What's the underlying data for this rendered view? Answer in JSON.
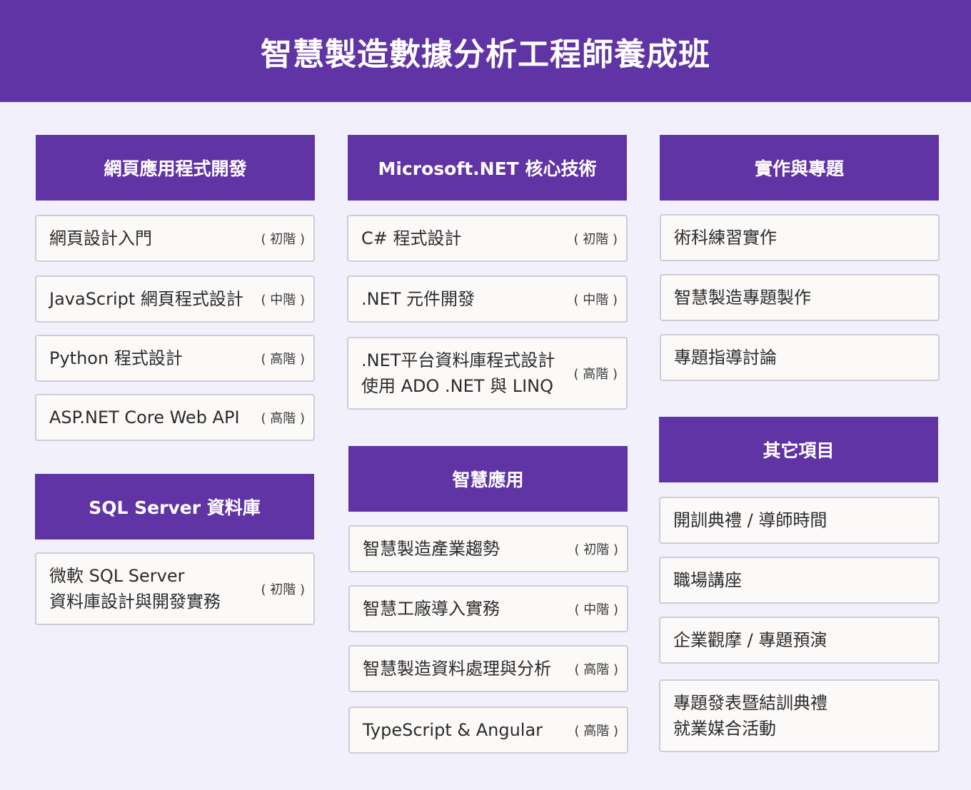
{
  "title": "智慧製造數據分析工程師養成班",
  "columns": [
    {
      "sections": [
        {
          "title": "網頁應用程式開發",
          "items": [
            {
              "lines": [
                "網頁設計入門"
              ],
              "level": "( 初階 )"
            },
            {
              "lines": [
                "JavaScript 網頁程式設計"
              ],
              "level": "( 中階 )"
            },
            {
              "lines": [
                "Python 程式設計"
              ],
              "level": "( 高階 )"
            },
            {
              "lines": [
                "ASP.NET Core Web API"
              ],
              "level": "( 高階 )"
            }
          ]
        },
        {
          "title": "SQL Server 資料庫",
          "items": [
            {
              "lines": [
                "微軟 SQL Server",
                "資料庫設計與開發實務"
              ],
              "level": "( 初階 )"
            }
          ]
        }
      ]
    },
    {
      "sections": [
        {
          "title": "Microsoft.NET 核心技術",
          "items": [
            {
              "lines": [
                "C# 程式設計"
              ],
              "level": "( 初階 )"
            },
            {
              "lines": [
                ".NET 元件開發"
              ],
              "level": "( 中階 )"
            },
            {
              "lines": [
                ".NET平台資料庫程式設計",
                "使用 ADO .NET 與 LINQ"
              ],
              "level": "( 高階 )"
            }
          ]
        },
        {
          "title": "智慧應用",
          "items": [
            {
              "lines": [
                "智慧製造產業趨勢"
              ],
              "level": "( 初階 )"
            },
            {
              "lines": [
                "智慧工廠導入實務"
              ],
              "level": "( 中階 )"
            },
            {
              "lines": [
                "智慧製造資料處理與分析"
              ],
              "level": "( 高階 )"
            },
            {
              "lines": [
                "TypeScript & Angular"
              ],
              "level": "( 高階 )"
            }
          ]
        }
      ]
    },
    {
      "sections": [
        {
          "title": "實作與專題",
          "items": [
            {
              "lines": [
                "術科練習實作"
              ]
            },
            {
              "lines": [
                "智慧製造專題製作"
              ]
            },
            {
              "lines": [
                "專題指導討論"
              ]
            }
          ]
        },
        {
          "title": "其它項目",
          "items": [
            {
              "lines": [
                "開訓典禮 / 導師時間"
              ]
            },
            {
              "lines": [
                "職場講座"
              ]
            },
            {
              "lines": [
                "企業觀摩 / 專題預演"
              ]
            },
            {
              "lines": [
                "專題發表暨結訓典禮",
                "就業媒合活動"
              ]
            }
          ]
        }
      ]
    }
  ]
}
